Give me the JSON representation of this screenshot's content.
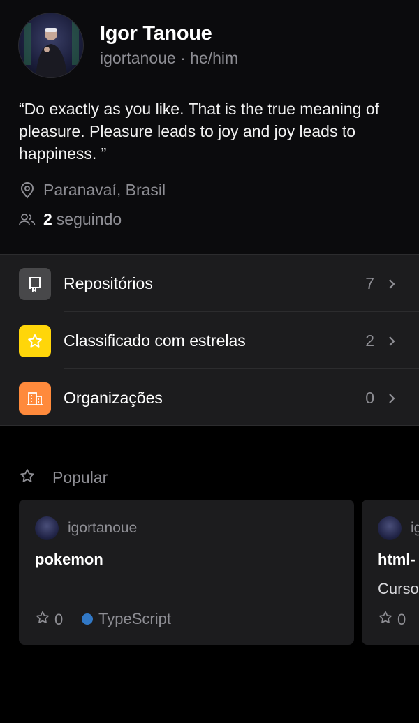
{
  "profile": {
    "name": "Igor Tanoue",
    "handle": "igortanoue · he/him",
    "bio": "“Do exactly as you like. That is the true meaning of pleasure. Pleasure leads to joy and joy leads to happiness. ”",
    "location": "Paranavaí, Brasil",
    "following_count": "2",
    "following_label": "seguindo"
  },
  "menu": {
    "items": [
      {
        "label": "Repositórios",
        "count": "7",
        "icon": "repo-icon",
        "color": "#48484a"
      },
      {
        "label": "Classificado com estrelas",
        "count": "2",
        "icon": "star-icon",
        "color": "#ffd60a"
      },
      {
        "label": "Organizações",
        "count": "0",
        "icon": "organization-icon",
        "color": "#ff8a3c"
      }
    ]
  },
  "popular": {
    "label": "Popular",
    "cards": [
      {
        "owner": "igortanoue",
        "repo": "pokemon",
        "description": "",
        "stars": "0",
        "language": "TypeScript",
        "language_color": "#3178c6"
      },
      {
        "owner": "ig",
        "repo": "html-",
        "description": "Curso",
        "stars": "0"
      }
    ]
  }
}
